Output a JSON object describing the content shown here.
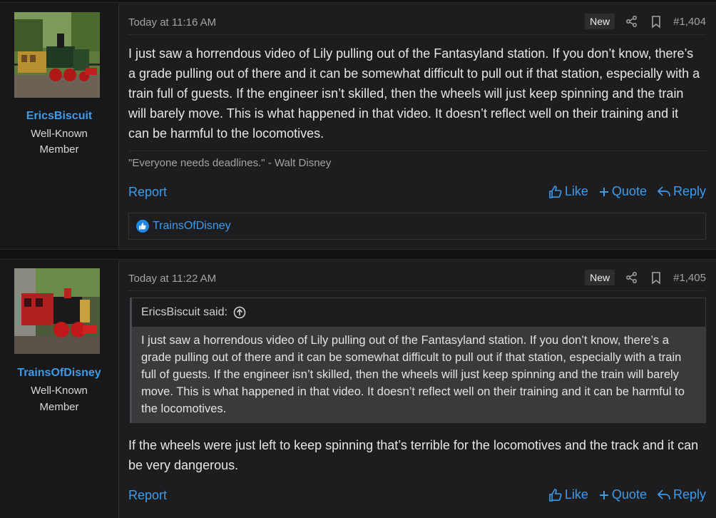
{
  "posts": [
    {
      "author": "EricsBiscuit",
      "user_title": [
        "Well-Known",
        "Member"
      ],
      "time": "Today at 11:16 AM",
      "badge": "New",
      "post_number": "#1,404",
      "body": "I just saw a horrendous video of Lily pulling out of the Fantasyland station. If you don’t know, there’s a grade pulling out of there and it can be somewhat difficult to pull out if that station, especially with a train full of guests. If the engineer isn’t skilled, then the wheels will just keep spinning and the train will barely move. This is what happened in that video. It doesn’t reflect well on their training and it can be harmful to the locomotives.",
      "signature": "\"Everyone needs deadlines.\" - Walt Disney",
      "report_label": "Report",
      "like_label": "Like",
      "quote_label": "Quote",
      "reply_label": "Reply",
      "reaction_user": "TrainsOfDisney"
    },
    {
      "author": "TrainsOfDisney",
      "user_title": [
        "Well-Known",
        "Member"
      ],
      "time": "Today at 11:22 AM",
      "badge": "New",
      "post_number": "#1,405",
      "quote_author": "EricsBiscuit said:",
      "quote_body": "I just saw a horrendous video of Lily pulling out of the Fantasyland station. If you don’t know, there’s a grade pulling out of there and it can be somewhat difficult to pull out if that station, especially with a train full of guests. If the engineer isn’t skilled, then the wheels will just keep spinning and the train will barely move. This is what happened in that video. It doesn’t reflect well on their training and it can be harmful to the locomotives.",
      "body": "If the wheels were just left to keep spinning that’s terrible for the locomotives and the track and it can be very dangerous.",
      "report_label": "Report",
      "like_label": "Like",
      "quote_label": "Quote",
      "reply_label": "Reply"
    }
  ],
  "icons": [
    "share-icon",
    "bookmark-icon",
    "thumbs-up-icon",
    "plus-icon",
    "reply-icon",
    "arrow-up-circle-icon"
  ],
  "colors": {
    "accent": "#3d9bea",
    "background": "#1d1d1f",
    "quote_bg": "#3a3a3c"
  }
}
